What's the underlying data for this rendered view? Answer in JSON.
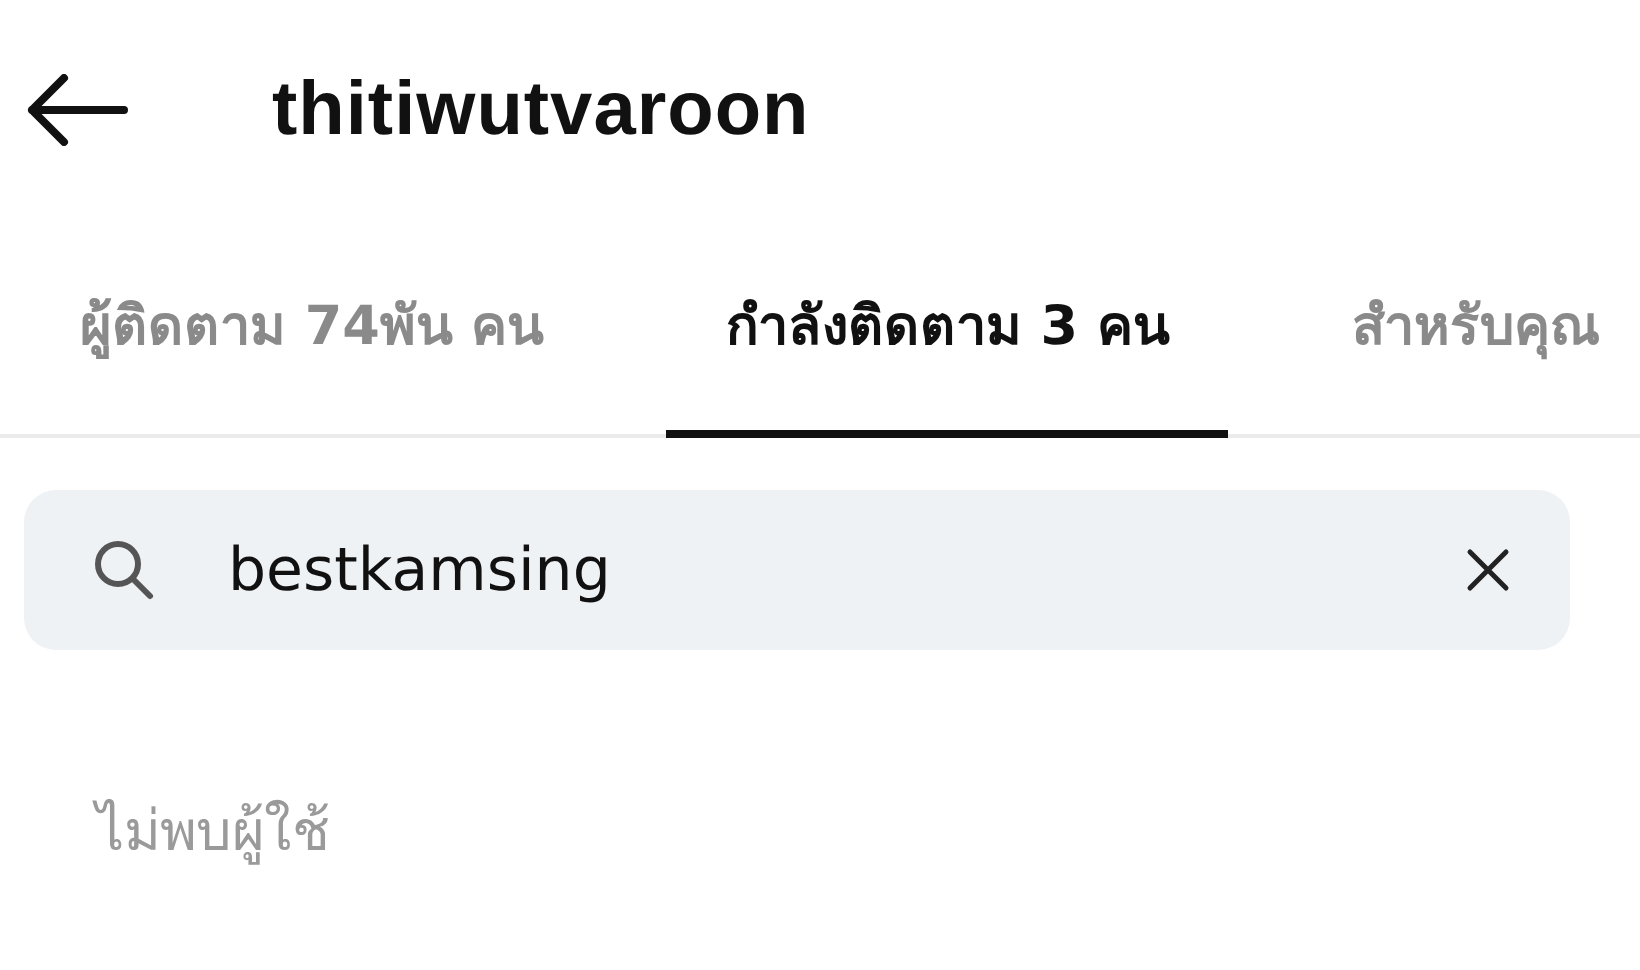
{
  "header": {
    "title": "thitiwutvaroon"
  },
  "tabs": [
    {
      "label": "ผู้ติดตาม 74พัน คน",
      "selected": false
    },
    {
      "label": "กำลังติดตาม 3 คน",
      "selected": true
    },
    {
      "label": "สำหรับคุณ",
      "selected": false
    }
  ],
  "search": {
    "value": "bestkamsing"
  },
  "empty_message": "ไม่พบผู้ใช้"
}
